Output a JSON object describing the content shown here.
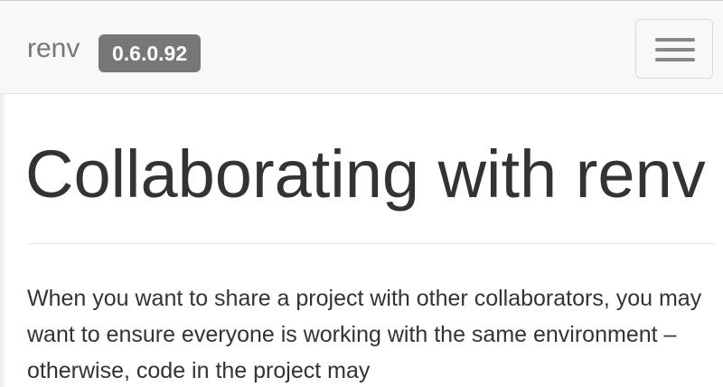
{
  "navbar": {
    "brand": "renv",
    "version": "0.6.0.92",
    "toggle_icon": "hamburger-menu-icon"
  },
  "main": {
    "title": "Collaborating with renv",
    "intro": "When you want to share a project with other collaborators, you may want to ensure everyone is working with the same environment – otherwise, code in the project may"
  },
  "colors": {
    "navbar_bg": "#f8f8f8",
    "brand_text": "#777777",
    "badge_bg": "#777777",
    "body_text": "#333333"
  }
}
